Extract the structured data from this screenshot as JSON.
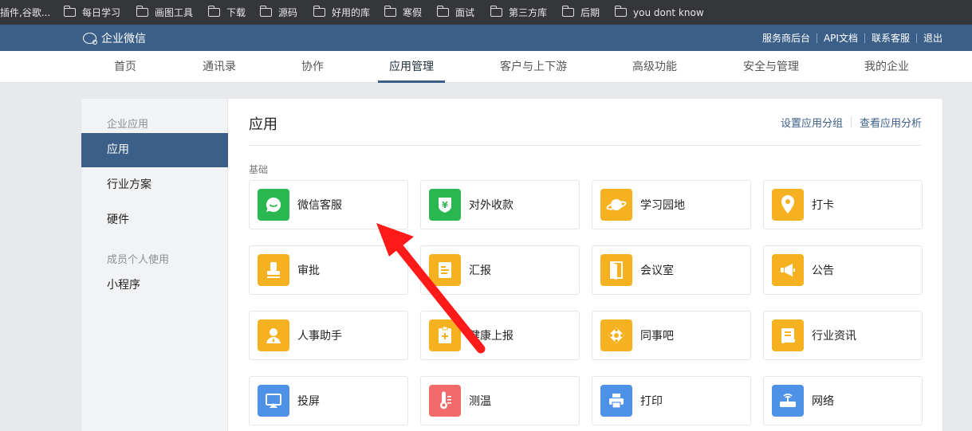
{
  "bookmarks": {
    "first": "插件,谷歌...",
    "folders": [
      "每日学习",
      "画图工具",
      "下载",
      "源码",
      "好用的库",
      "寒假",
      "面试",
      "第三方库",
      "后期",
      "you dont know"
    ]
  },
  "header": {
    "logo_text": "企业微信",
    "links": [
      "服务商后台",
      "API文档",
      "联系客服",
      "退出"
    ]
  },
  "tabs": [
    "首页",
    "通讯录",
    "协作",
    "应用管理",
    "客户与上下游",
    "高级功能",
    "安全与管理",
    "我的企业"
  ],
  "active_tab": "应用管理",
  "sidebar": {
    "group1": "企业应用",
    "items1": [
      "应用",
      "行业方案",
      "硬件"
    ],
    "group2": "成员个人使用",
    "items2": [
      "小程序"
    ]
  },
  "content": {
    "title": "应用",
    "actions": [
      "设置应用分组",
      "查看应用分析"
    ],
    "section": "基础",
    "apps": [
      {
        "label": "微信客服",
        "icon": "wechat-service-icon",
        "color": "#2bb74f"
      },
      {
        "label": "对外收款",
        "icon": "yuan-shield-icon",
        "color": "#2bb74f"
      },
      {
        "label": "学习园地",
        "icon": "planet-icon",
        "color": "#f5b120"
      },
      {
        "label": "打卡",
        "icon": "location-pin-icon",
        "color": "#f5b120"
      },
      {
        "label": "审批",
        "icon": "stamp-icon",
        "color": "#f5b120"
      },
      {
        "label": "汇报",
        "icon": "report-doc-icon",
        "color": "#f5b120"
      },
      {
        "label": "会议室",
        "icon": "door-icon",
        "color": "#f5b120"
      },
      {
        "label": "公告",
        "icon": "megaphone-icon",
        "color": "#f5b120"
      },
      {
        "label": "人事助手",
        "icon": "person-icon",
        "color": "#f5b120"
      },
      {
        "label": "健康上报",
        "icon": "health-clipboard-icon",
        "color": "#f5b120"
      },
      {
        "label": "同事吧",
        "icon": "colleague-network-icon",
        "color": "#f5b120"
      },
      {
        "label": "行业资讯",
        "icon": "scroll-icon",
        "color": "#f5b120"
      },
      {
        "label": "投屏",
        "icon": "screen-cast-icon",
        "color": "#4e92e8"
      },
      {
        "label": "测温",
        "icon": "thermometer-icon",
        "color": "#f26a6a"
      },
      {
        "label": "打印",
        "icon": "printer-icon",
        "color": "#4e92e8"
      },
      {
        "label": "网络",
        "icon": "router-icon",
        "color": "#4e92e8"
      }
    ]
  }
}
